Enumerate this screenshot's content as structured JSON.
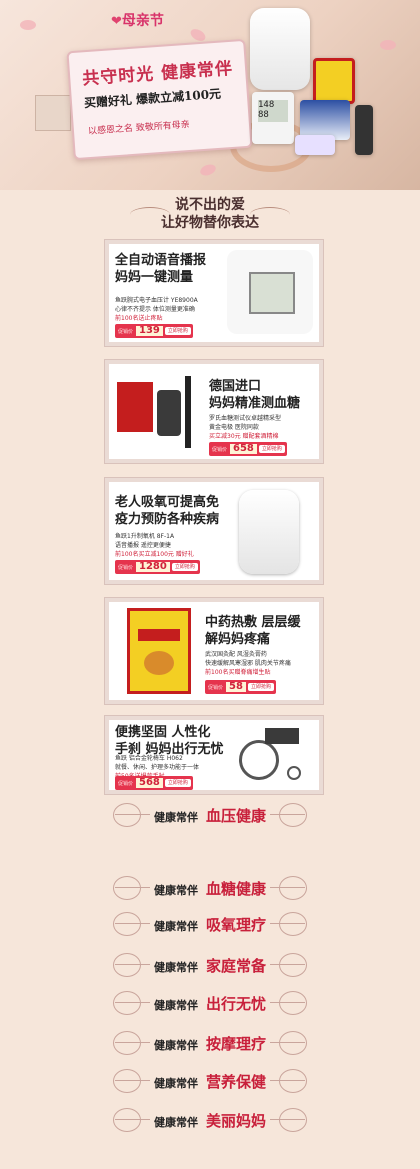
{
  "banner": {
    "logo": "母亲节",
    "title": "共守时光 健康常伴",
    "subtitle": "买赠好礼 爆款立减100元",
    "tagline": "以感恩之名 致敬所有母亲",
    "bp_reading": "148 88"
  },
  "headline": {
    "line1": "说不出的爱",
    "line2": "让好物替你表达"
  },
  "products": [
    {
      "title": "全自动语音播报\n妈妈一键测量",
      "desc": [
        "鱼跃腕式电子血压计 YE8900A",
        "心律不齐提示 体位测量更准确"
      ],
      "promo": "前100名送止疼贴",
      "price_label": "促销价",
      "price": "139",
      "buy": "立即抢购"
    },
    {
      "title": "德国进口\n妈妈精准测血糖",
      "desc": [
        "罗氏血糖测试仪卓越精采型",
        "黄金电极 医院同款"
      ],
      "promo": "买立减30元 赠配套酒精棉",
      "price_label": "促销价",
      "price": "658",
      "buy": "立即抢购"
    },
    {
      "title": "老人吸氧可提高免\n疫力预防各种疾病",
      "desc": [
        "鱼跃1升制氧机 8F-1A",
        "语音播报 遥控更便捷"
      ],
      "promo": "前100名买立减100元 赠好礼",
      "price_label": "促销价",
      "price": "1280",
      "buy": "立即抢购"
    },
    {
      "title": "中药热敷 层层缓\n解妈妈疼痛",
      "desc": [
        "武汉国灸配 风湿灸膏药",
        "快速缓解风寒湿邪 肌肉关节疼痛"
      ],
      "promo": "前100名买赠脊痛增生贴",
      "price_label": "促销价",
      "price": "58",
      "buy": "立即抢购"
    },
    {
      "title": "便携坚固 人性化\n手刹 妈妈出行无忧",
      "desc": [
        "鱼跃 铝合金轮椅车 H062",
        "就餐、休闲、护理多功能于一体"
      ],
      "promo": "前50名送爆款手杖",
      "price_label": "促销价",
      "price": "568",
      "buy": "立即抢购"
    }
  ],
  "categories": [
    {
      "prefix": "健康常伴",
      "name": "血压健康"
    },
    {
      "prefix": "健康常伴",
      "name": "血糖健康"
    },
    {
      "prefix": "健康常伴",
      "name": "吸氧理疗"
    },
    {
      "prefix": "健康常伴",
      "name": "家庭常备"
    },
    {
      "prefix": "健康常伴",
      "name": "出行无忧"
    },
    {
      "prefix": "健康常伴",
      "name": "按摩理疗"
    },
    {
      "prefix": "健康常伴",
      "name": "营养保健"
    },
    {
      "prefix": "健康常伴",
      "name": "美丽妈妈"
    }
  ],
  "colors": {
    "accent": "#c8203b",
    "price_bg": "#e5344d",
    "page_bg": "#f6e6da"
  }
}
